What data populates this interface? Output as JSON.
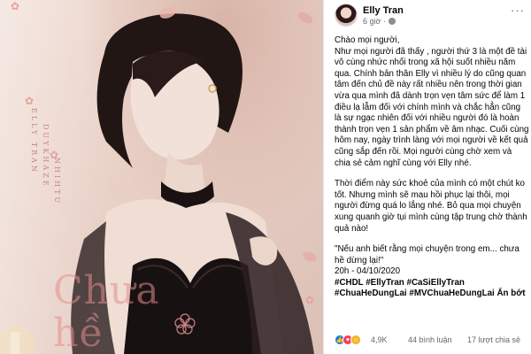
{
  "photo": {
    "vertical_text_1": "ELLY TRAN",
    "vertical_text_2": "DUYKHAZE",
    "vertical_text_3": "NHIHTU",
    "song_title": "Chưa hề"
  },
  "post": {
    "author": "Elly Tran",
    "time": "6 giờ ·",
    "paragraphs": [
      "Chào mọi người,",
      "Như mọi người đã thấy , người thứ 3 là một đề tài vô cùng nhức nhối trong xã hội suốt nhiều năm qua. Chính bản thân Elly vì nhiều lý do cũng quan tâm đến chủ đề này rất nhiều nên trong thời gian vừa qua mình đã dành trọn vẹn tâm sức để làm 1 điều lạ lẫm đối với chính mình và chắc hẳn cũng là sự ngạc nhiên đối với nhiều người đó là hoàn thành trọn vẹn 1 sản phẩm về âm nhạc. Cuối cùng hôm nay, ngày trình làng với mọi người về kết quả cũng sắp đến rồi. Mọi người cùng chờ xem và chia sẻ cảm nghĩ cùng với Elly nhé.",
      "Thời điểm này sức khoẻ của mình có một chút ko tốt. Nhưng mình sẽ mau hồi phục lại thôi, mọi người đừng quá lo lắng nhé. Bỏ qua mọi chuyện xung quanh giờ tụi mình cùng tập trung chờ thành quả nào!",
      "\"Nếu anh biết rằng mọi chuyện trong em... chưa hề dừng lại!\""
    ],
    "schedule": "20h - 04/10/2020",
    "hashtags": [
      "#CHDL",
      "#EllyTran",
      "#CaSiEllyTran",
      "#ChuaHeDungLai",
      "#MVChuaHeDungLai"
    ],
    "see_more": "Ẩn bớt",
    "reaction_count": "4,9K",
    "comments": "44 bình luận",
    "shares": "17 lượt chia sẻ"
  },
  "colors": {
    "like": "#1877f2",
    "love": "#f33e58",
    "haha": "#f7b125"
  }
}
